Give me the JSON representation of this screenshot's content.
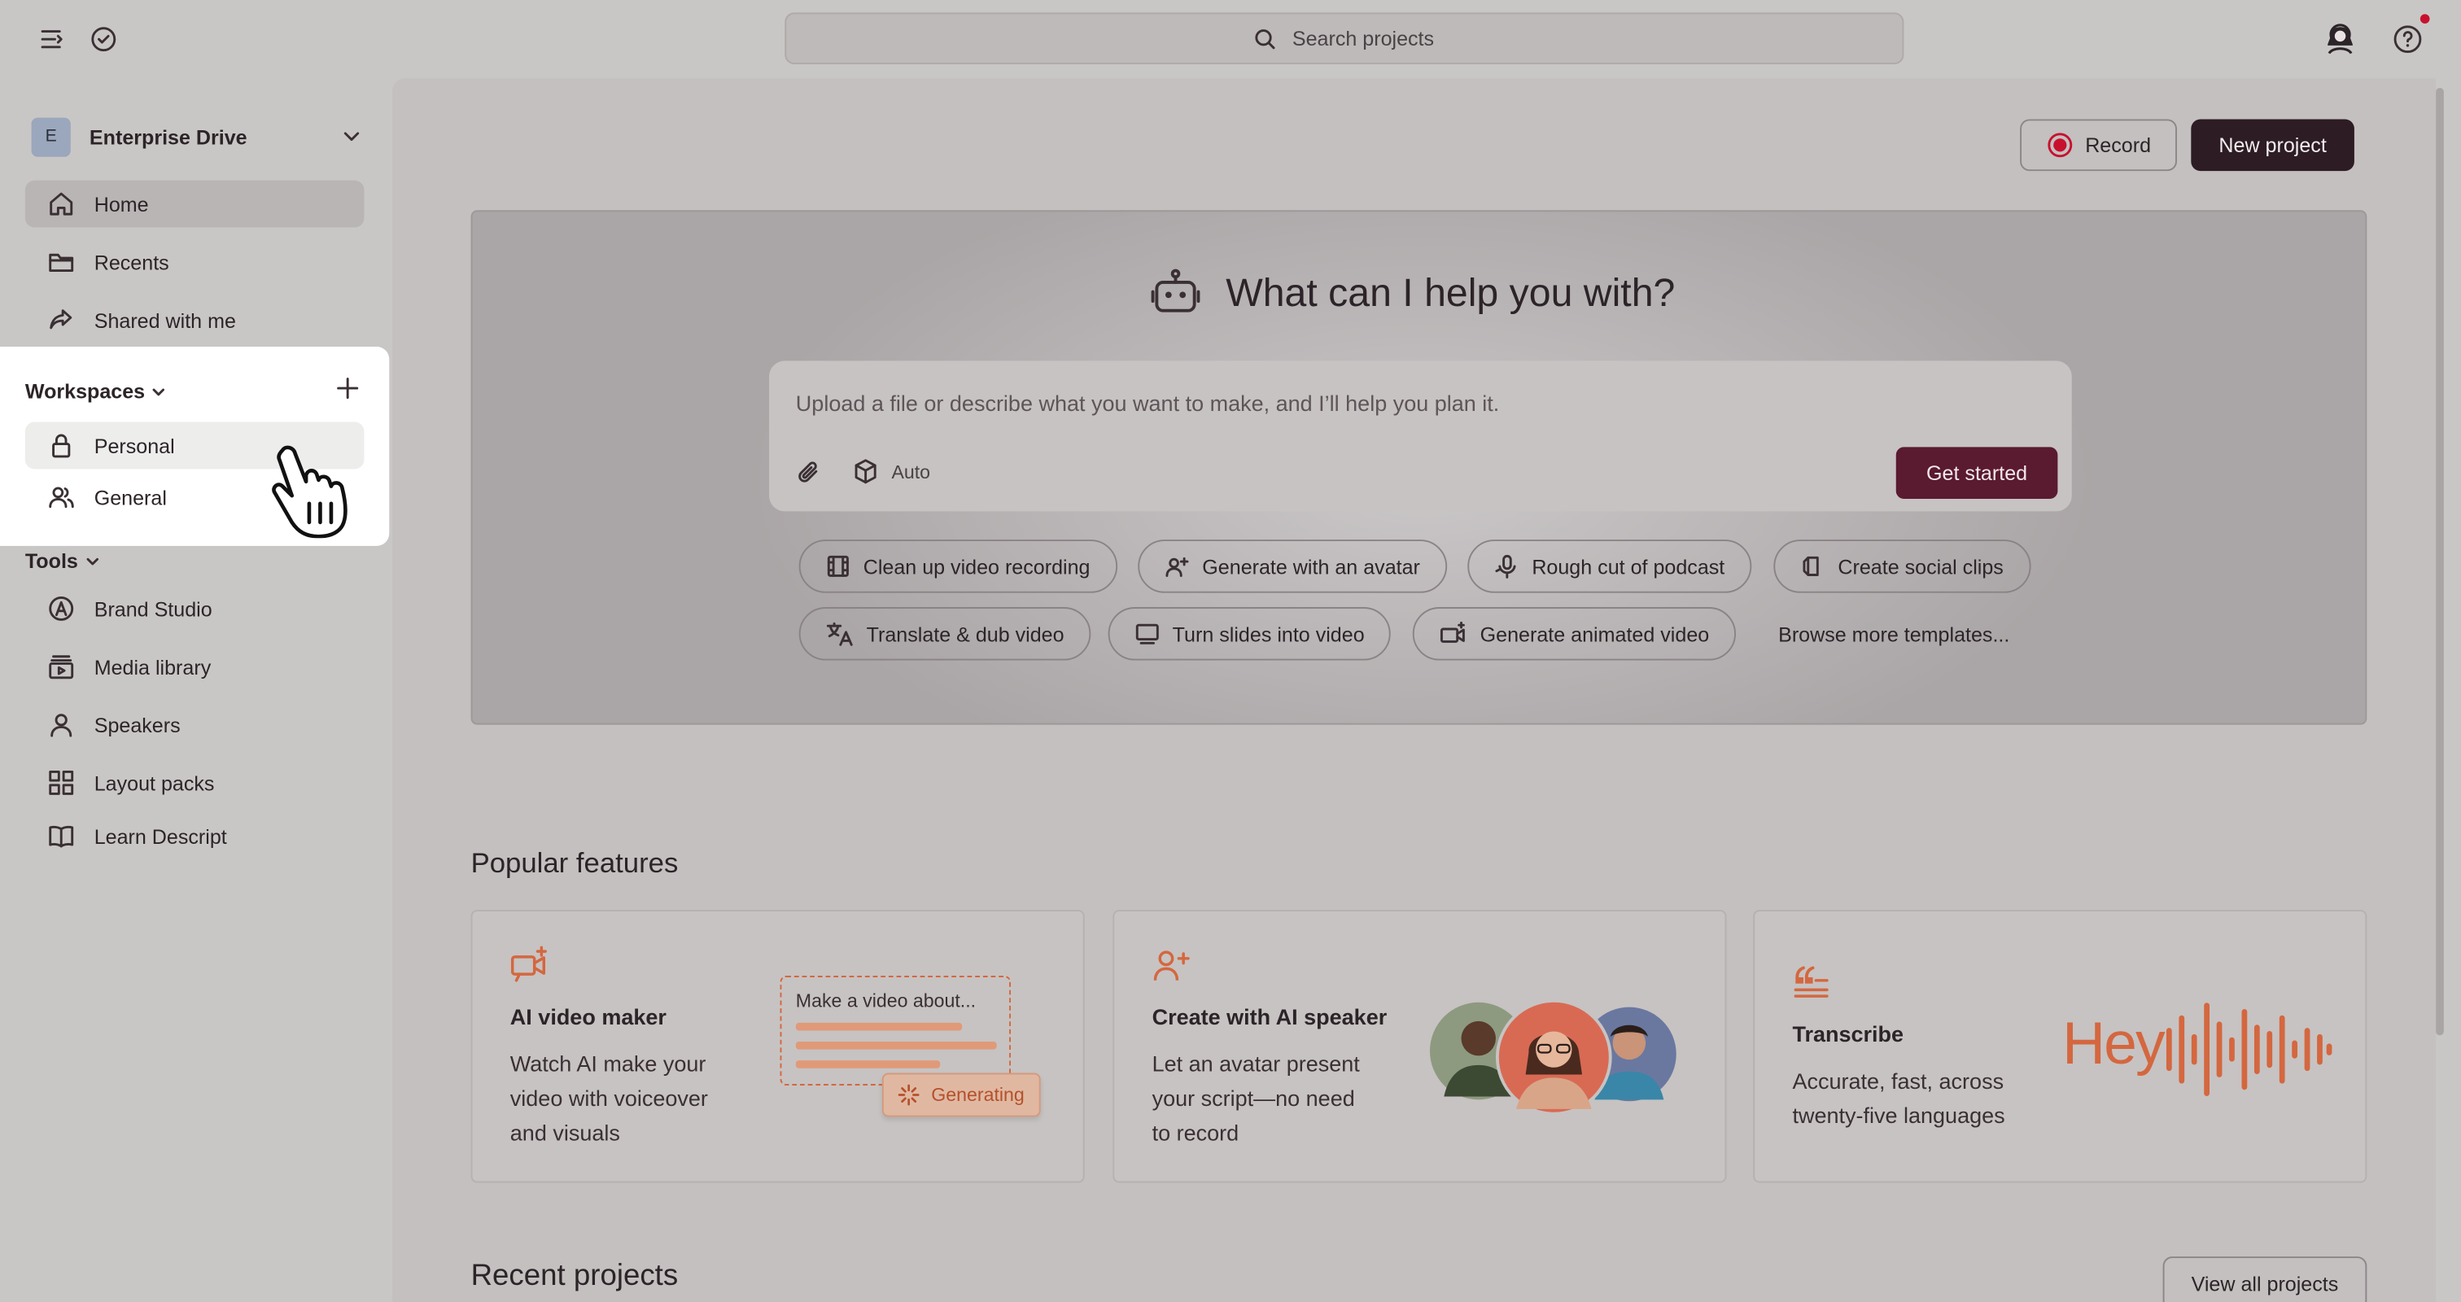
{
  "topbar": {
    "search_placeholder": "Search projects",
    "icons": [
      "menu-icon",
      "check-circle-icon",
      "avatar-icon",
      "help-icon"
    ],
    "notification_color": "#c8102e"
  },
  "sidebar": {
    "drive": {
      "initial": "E",
      "name": "Enterprise Drive"
    },
    "nav": [
      {
        "label": "Home",
        "icon": "home-icon",
        "selected": true
      },
      {
        "label": "Recents",
        "icon": "folder-icon"
      },
      {
        "label": "Shared with me",
        "icon": "share-icon"
      }
    ],
    "workspaces": {
      "title": "Workspaces",
      "items": [
        {
          "label": "Personal",
          "icon": "lock-icon",
          "selected": true
        },
        {
          "label": "General",
          "icon": "users-icon"
        }
      ]
    },
    "tools": {
      "title": "Tools",
      "items": [
        {
          "label": "Brand Studio",
          "icon": "brand-icon"
        },
        {
          "label": "Media library",
          "icon": "media-library-icon"
        },
        {
          "label": "Speakers",
          "icon": "person-icon"
        },
        {
          "label": "Layout packs",
          "icon": "grid-icon"
        },
        {
          "label": "Learn Descript",
          "icon": "book-icon"
        }
      ]
    }
  },
  "header": {
    "record_label": "Record",
    "new_project_label": "New project",
    "record_color": "#c8102e"
  },
  "hero": {
    "title": "What can I help you with?",
    "prompt_placeholder": "Upload a file or describe what you want to make, and I’ll help you plan it.",
    "model_label": "Auto",
    "get_started_label": "Get started",
    "get_started_color": "#5a1a30",
    "templates_row1": [
      {
        "label": "Clean up video recording",
        "icon": "film-icon"
      },
      {
        "label": "Generate with an avatar",
        "icon": "avatar-sparkle-icon"
      },
      {
        "label": "Rough cut of podcast",
        "icon": "mic-icon"
      },
      {
        "label": "Create social clips",
        "icon": "social-clip-icon"
      }
    ],
    "templates_row2": [
      {
        "label": "Translate & dub video",
        "icon": "translate-icon"
      },
      {
        "label": "Turn slides into video",
        "icon": "slides-icon"
      },
      {
        "label": "Generate animated video",
        "icon": "animated-video-icon"
      }
    ],
    "browse_label": "Browse more templates..."
  },
  "popular": {
    "title": "Popular features",
    "accent_color": "#d4673f",
    "cards": [
      {
        "title": "AI video maker",
        "desc": [
          "Watch AI make your",
          "video with voiceover",
          "and visuals"
        ],
        "illustration_text": "Make a video about...",
        "badge": "Generating"
      },
      {
        "title": "Create with AI speaker",
        "desc": [
          "Let an avatar present",
          "your script—no need",
          "to record"
        ]
      },
      {
        "title": "Transcribe",
        "desc": [
          "Accurate, fast, across",
          "twenty-five languages"
        ],
        "illustration_text": "Hey"
      }
    ]
  },
  "recent": {
    "title": "Recent projects",
    "view_all_label": "View all projects"
  }
}
